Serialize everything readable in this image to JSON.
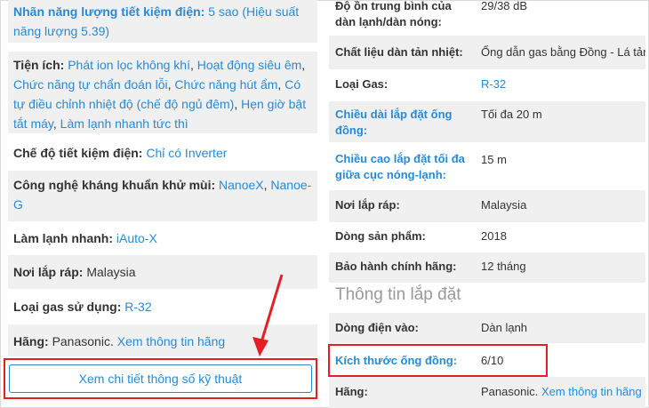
{
  "left": {
    "energy_label": "Nhãn năng lượng tiết kiệm điện:",
    "energy_value": "5 sao (Hiệu suất năng lượng 5.39)",
    "utilities_label": "Tiện ích:",
    "utilities_values": [
      "Phát ion lọc không khí",
      "Hoạt động siêu êm",
      "Chức năng tự chẩn đoán lỗi",
      "Chức năng hút ẩm",
      "Có tự điều chỉnh nhiệt độ (chế độ ngủ đêm)",
      "Hẹn giờ bật tắt máy",
      "Làm lạnh nhanh tức thì"
    ],
    "saving_label": "Chế độ tiết kiệm điện:",
    "saving_value": "Chỉ có Inverter",
    "antibac_label": "Công nghệ kháng khuẩn khử mùi:",
    "antibac_values": [
      "NanoeX",
      "Nanoe-G"
    ],
    "fastcool_label": "Làm lạnh nhanh:",
    "fastcool_value": "iAuto-X",
    "assembly_label": "Nơi lắp ráp:",
    "assembly_value": "Malaysia",
    "gas_label": "Loại gas sử dụng:",
    "gas_value": "R-32",
    "brand_label": "Hãng:",
    "brand_value": "Panasonic.",
    "brand_link": "Xem thông tin hãng",
    "details_button": "Xem chi tiết thông số kỹ thuật"
  },
  "right": {
    "noise_label": "Độ ồn trung bình của dàn lạnh/dàn nóng:",
    "noise_value": "29/38 dB",
    "radiator_label": "Chất liệu dàn tản nhiệt:",
    "radiator_value": "Ống dẫn gas bằng Đồng - Lá tản",
    "gas_label": "Loại Gas:",
    "gas_value": "R-32",
    "pipe_length_label": "Chiều dài lắp đặt ống đồng:",
    "pipe_length_value": "Tối đa 20 m",
    "height_label": "Chiều cao lắp đặt tối đa giữa cục nóng-lạnh:",
    "height_value": "15 m",
    "assembly_label": "Nơi lắp ráp:",
    "assembly_value": "Malaysia",
    "line_label": "Dòng sản phẩm:",
    "line_value": "2018",
    "warranty_label": "Bảo hành chính hãng:",
    "warranty_value": "12 tháng",
    "install_section": "Thông tin lắp đặt",
    "power_label": "Dòng điện vào:",
    "power_value": "Dàn lạnh",
    "pipe_size_label": "Kích thước ống đồng:",
    "pipe_size_value": "6/10",
    "brand_label": "Hãng:",
    "brand_value": "Panasonic.",
    "brand_link": "Xem thông tin hãng"
  },
  "colors": {
    "link": "#288ad6",
    "highlight": "#e31e24",
    "row_shade": "#f0f0f0"
  }
}
